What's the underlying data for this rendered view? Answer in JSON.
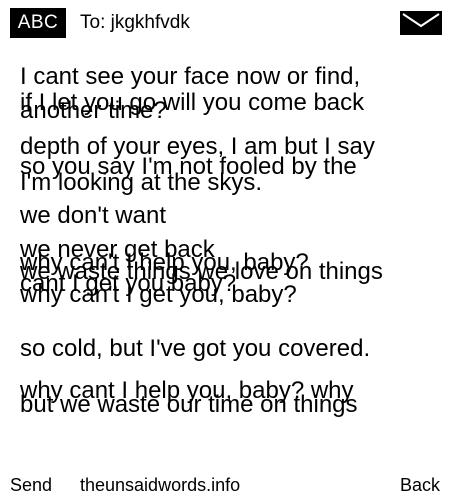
{
  "header": {
    "logo": "ABC",
    "to": "To: jkgkhfvdk",
    "mail_icon": "envelope-icon"
  },
  "lyrics": [
    "I cant see your face now or find,",
    "another time?",
    "if I let you go will you come back",
    "depth of your eyes, I am but I say",
    "so you say I'm not fooled by the",
    "I'm looking at the skys.",
    "we don't want",
    "we never get back",
    "why can't I help you, baby?",
    "we waste things we love on things",
    "cant I get you baby?",
    "why can't I get you, baby?",
    "so cold, but I've got you covered.",
    "why cant I help you, baby? why",
    "but we waste our time on things"
  ],
  "footer": {
    "send": "Send",
    "site": "theunsaidwords.info",
    "back": "Back"
  }
}
